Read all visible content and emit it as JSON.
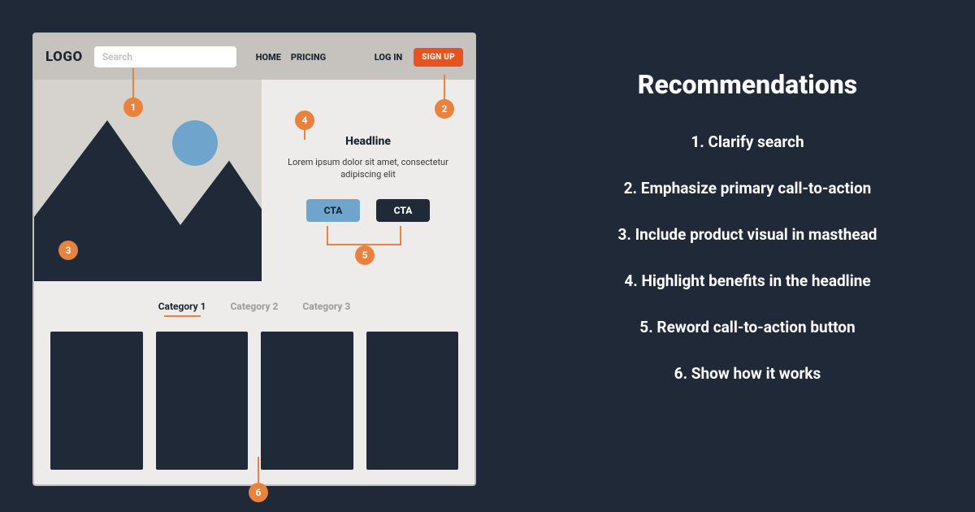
{
  "wireframe": {
    "logo": "LOGO",
    "search_placeholder": "Search",
    "nav": {
      "home": "HOME",
      "pricing": "PRICING"
    },
    "auth": {
      "login": "LOG IN",
      "signup": "SIGN UP"
    },
    "hero": {
      "headline": "Headline",
      "lorem": "Lorem ipsum dolor sit amet, consectetur adipiscing elit",
      "cta1": "CTA",
      "cta2": "CTA"
    },
    "categories": {
      "c1": "Category 1",
      "c2": "Category 2",
      "c3": "Category 3"
    },
    "markers": {
      "m1": "1",
      "m2": "2",
      "m3": "3",
      "m4": "4",
      "m5": "5",
      "m6": "6"
    }
  },
  "recommendations": {
    "title": "Recommendations",
    "items": {
      "r1": "1. Clarify search",
      "r2": "2. Emphasize primary call-to-action",
      "r3": "3. Include product visual in masthead",
      "r4": "4. Highlight benefits in the headline",
      "r5": "5. Reword call-to-action button",
      "r6": "6. Show how it works"
    }
  }
}
